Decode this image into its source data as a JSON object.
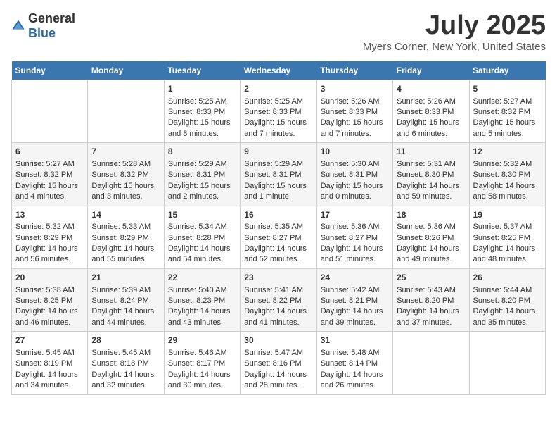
{
  "header": {
    "logo_general": "General",
    "logo_blue": "Blue",
    "title": "July 2025",
    "subtitle": "Myers Corner, New York, United States"
  },
  "days_of_week": [
    "Sunday",
    "Monday",
    "Tuesday",
    "Wednesday",
    "Thursday",
    "Friday",
    "Saturday"
  ],
  "weeks": [
    [
      {
        "day": "",
        "info": ""
      },
      {
        "day": "",
        "info": ""
      },
      {
        "day": "1",
        "info": "Sunrise: 5:25 AM\nSunset: 8:33 PM\nDaylight: 15 hours and 8 minutes."
      },
      {
        "day": "2",
        "info": "Sunrise: 5:25 AM\nSunset: 8:33 PM\nDaylight: 15 hours and 7 minutes."
      },
      {
        "day": "3",
        "info": "Sunrise: 5:26 AM\nSunset: 8:33 PM\nDaylight: 15 hours and 7 minutes."
      },
      {
        "day": "4",
        "info": "Sunrise: 5:26 AM\nSunset: 8:33 PM\nDaylight: 15 hours and 6 minutes."
      },
      {
        "day": "5",
        "info": "Sunrise: 5:27 AM\nSunset: 8:32 PM\nDaylight: 15 hours and 5 minutes."
      }
    ],
    [
      {
        "day": "6",
        "info": "Sunrise: 5:27 AM\nSunset: 8:32 PM\nDaylight: 15 hours and 4 minutes."
      },
      {
        "day": "7",
        "info": "Sunrise: 5:28 AM\nSunset: 8:32 PM\nDaylight: 15 hours and 3 minutes."
      },
      {
        "day": "8",
        "info": "Sunrise: 5:29 AM\nSunset: 8:31 PM\nDaylight: 15 hours and 2 minutes."
      },
      {
        "day": "9",
        "info": "Sunrise: 5:29 AM\nSunset: 8:31 PM\nDaylight: 15 hours and 1 minute."
      },
      {
        "day": "10",
        "info": "Sunrise: 5:30 AM\nSunset: 8:31 PM\nDaylight: 15 hours and 0 minutes."
      },
      {
        "day": "11",
        "info": "Sunrise: 5:31 AM\nSunset: 8:30 PM\nDaylight: 14 hours and 59 minutes."
      },
      {
        "day": "12",
        "info": "Sunrise: 5:32 AM\nSunset: 8:30 PM\nDaylight: 14 hours and 58 minutes."
      }
    ],
    [
      {
        "day": "13",
        "info": "Sunrise: 5:32 AM\nSunset: 8:29 PM\nDaylight: 14 hours and 56 minutes."
      },
      {
        "day": "14",
        "info": "Sunrise: 5:33 AM\nSunset: 8:29 PM\nDaylight: 14 hours and 55 minutes."
      },
      {
        "day": "15",
        "info": "Sunrise: 5:34 AM\nSunset: 8:28 PM\nDaylight: 14 hours and 54 minutes."
      },
      {
        "day": "16",
        "info": "Sunrise: 5:35 AM\nSunset: 8:27 PM\nDaylight: 14 hours and 52 minutes."
      },
      {
        "day": "17",
        "info": "Sunrise: 5:36 AM\nSunset: 8:27 PM\nDaylight: 14 hours and 51 minutes."
      },
      {
        "day": "18",
        "info": "Sunrise: 5:36 AM\nSunset: 8:26 PM\nDaylight: 14 hours and 49 minutes."
      },
      {
        "day": "19",
        "info": "Sunrise: 5:37 AM\nSunset: 8:25 PM\nDaylight: 14 hours and 48 minutes."
      }
    ],
    [
      {
        "day": "20",
        "info": "Sunrise: 5:38 AM\nSunset: 8:25 PM\nDaylight: 14 hours and 46 minutes."
      },
      {
        "day": "21",
        "info": "Sunrise: 5:39 AM\nSunset: 8:24 PM\nDaylight: 14 hours and 44 minutes."
      },
      {
        "day": "22",
        "info": "Sunrise: 5:40 AM\nSunset: 8:23 PM\nDaylight: 14 hours and 43 minutes."
      },
      {
        "day": "23",
        "info": "Sunrise: 5:41 AM\nSunset: 8:22 PM\nDaylight: 14 hours and 41 minutes."
      },
      {
        "day": "24",
        "info": "Sunrise: 5:42 AM\nSunset: 8:21 PM\nDaylight: 14 hours and 39 minutes."
      },
      {
        "day": "25",
        "info": "Sunrise: 5:43 AM\nSunset: 8:20 PM\nDaylight: 14 hours and 37 minutes."
      },
      {
        "day": "26",
        "info": "Sunrise: 5:44 AM\nSunset: 8:20 PM\nDaylight: 14 hours and 35 minutes."
      }
    ],
    [
      {
        "day": "27",
        "info": "Sunrise: 5:45 AM\nSunset: 8:19 PM\nDaylight: 14 hours and 34 minutes."
      },
      {
        "day": "28",
        "info": "Sunrise: 5:45 AM\nSunset: 8:18 PM\nDaylight: 14 hours and 32 minutes."
      },
      {
        "day": "29",
        "info": "Sunrise: 5:46 AM\nSunset: 8:17 PM\nDaylight: 14 hours and 30 minutes."
      },
      {
        "day": "30",
        "info": "Sunrise: 5:47 AM\nSunset: 8:16 PM\nDaylight: 14 hours and 28 minutes."
      },
      {
        "day": "31",
        "info": "Sunrise: 5:48 AM\nSunset: 8:14 PM\nDaylight: 14 hours and 26 minutes."
      },
      {
        "day": "",
        "info": ""
      },
      {
        "day": "",
        "info": ""
      }
    ]
  ]
}
